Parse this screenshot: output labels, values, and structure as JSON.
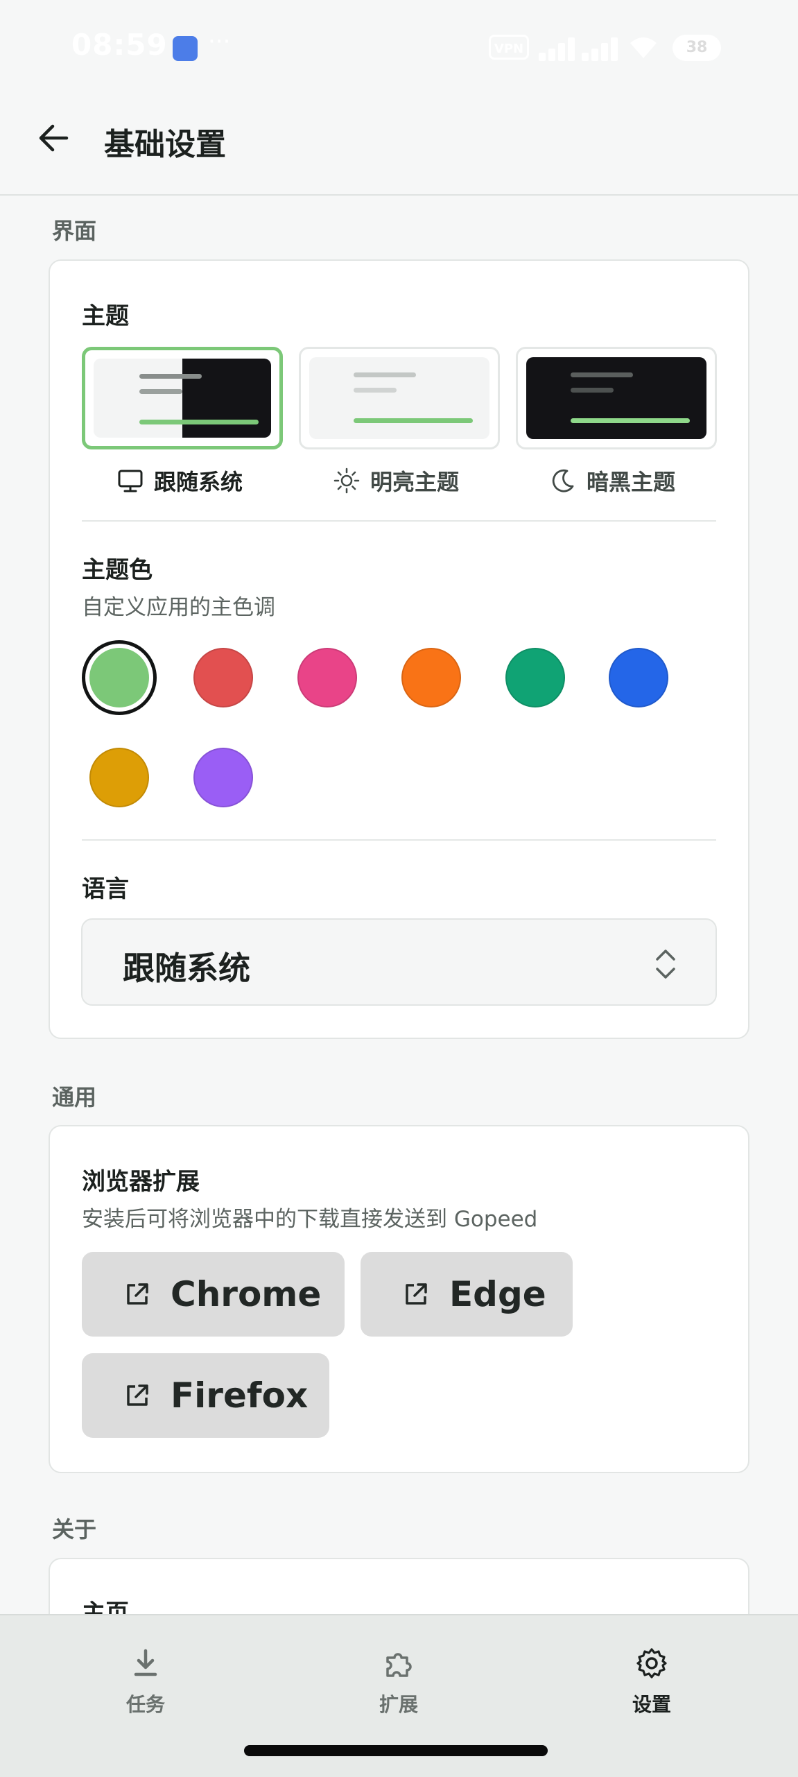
{
  "status_bar": {
    "time": "08:59",
    "dots": "···",
    "vpn": "VPN",
    "battery": "38"
  },
  "header": {
    "title": "基础设置"
  },
  "sections": {
    "interface": "界面",
    "general": "通用",
    "about": "关于"
  },
  "theme": {
    "title": "主题",
    "options": [
      {
        "label": "跟随系统",
        "icon": "monitor-icon"
      },
      {
        "label": "明亮主题",
        "icon": "sun-icon"
      },
      {
        "label": "暗黑主题",
        "icon": "moon-icon"
      }
    ],
    "selected_index": 0
  },
  "theme_color": {
    "title": "主题色",
    "description": "自定义应用的主色调",
    "colors": [
      "#7cc878",
      "#e25050",
      "#e94488",
      "#f97316",
      "#10a374",
      "#2466e8",
      "#dd9e06",
      "#9a5ef5"
    ],
    "selected_index": 0
  },
  "language": {
    "title": "语言",
    "value": "跟随系统"
  },
  "browser_extension": {
    "title": "浏览器扩展",
    "description": "安装后可将浏览器中的下载直接发送到 Gopeed",
    "buttons": [
      "Chrome",
      "Edge",
      "Firefox"
    ]
  },
  "about": {
    "homepage_title": "主页"
  },
  "bottom_nav": {
    "items": [
      {
        "label": "任务",
        "icon": "download-icon"
      },
      {
        "label": "扩展",
        "icon": "puzzle-icon"
      },
      {
        "label": "设置",
        "icon": "gear-icon"
      }
    ],
    "active_index": 2
  }
}
